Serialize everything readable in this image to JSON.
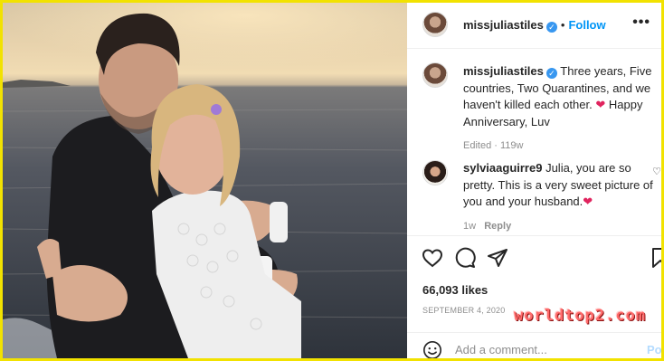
{
  "post": {
    "username": "missjuliastiles",
    "follow_label": "Follow",
    "caption_text": "Three years, Five countries, Two Quarantines, and we haven't killed each other.",
    "caption_heart": "❤",
    "caption_tail": "Happy Anniversary, Luv",
    "edited_label": "Edited",
    "age": "119w"
  },
  "comment": {
    "username": "sylviaaguirre9",
    "text": "Julia, you are so pretty. This is a very sweet picture of you and your husband.",
    "heart": "❤",
    "age": "1w",
    "reply_label": "Reply"
  },
  "stats": {
    "likes": "66,093 likes",
    "date": "SEPTEMBER 4, 2020"
  },
  "comment_box": {
    "placeholder": "Add a comment...",
    "post_label": "Pos"
  },
  "watermark": "worldtop2.com",
  "colors": {
    "frame": "#f2e200",
    "link": "#0095f6",
    "verified": "#3897f0",
    "heart": "#e0245e"
  },
  "icons": [
    "verified-badge-icon",
    "more-options-icon",
    "heart-icon",
    "comment-icon",
    "share-icon",
    "bookmark-icon",
    "emoji-icon"
  ]
}
